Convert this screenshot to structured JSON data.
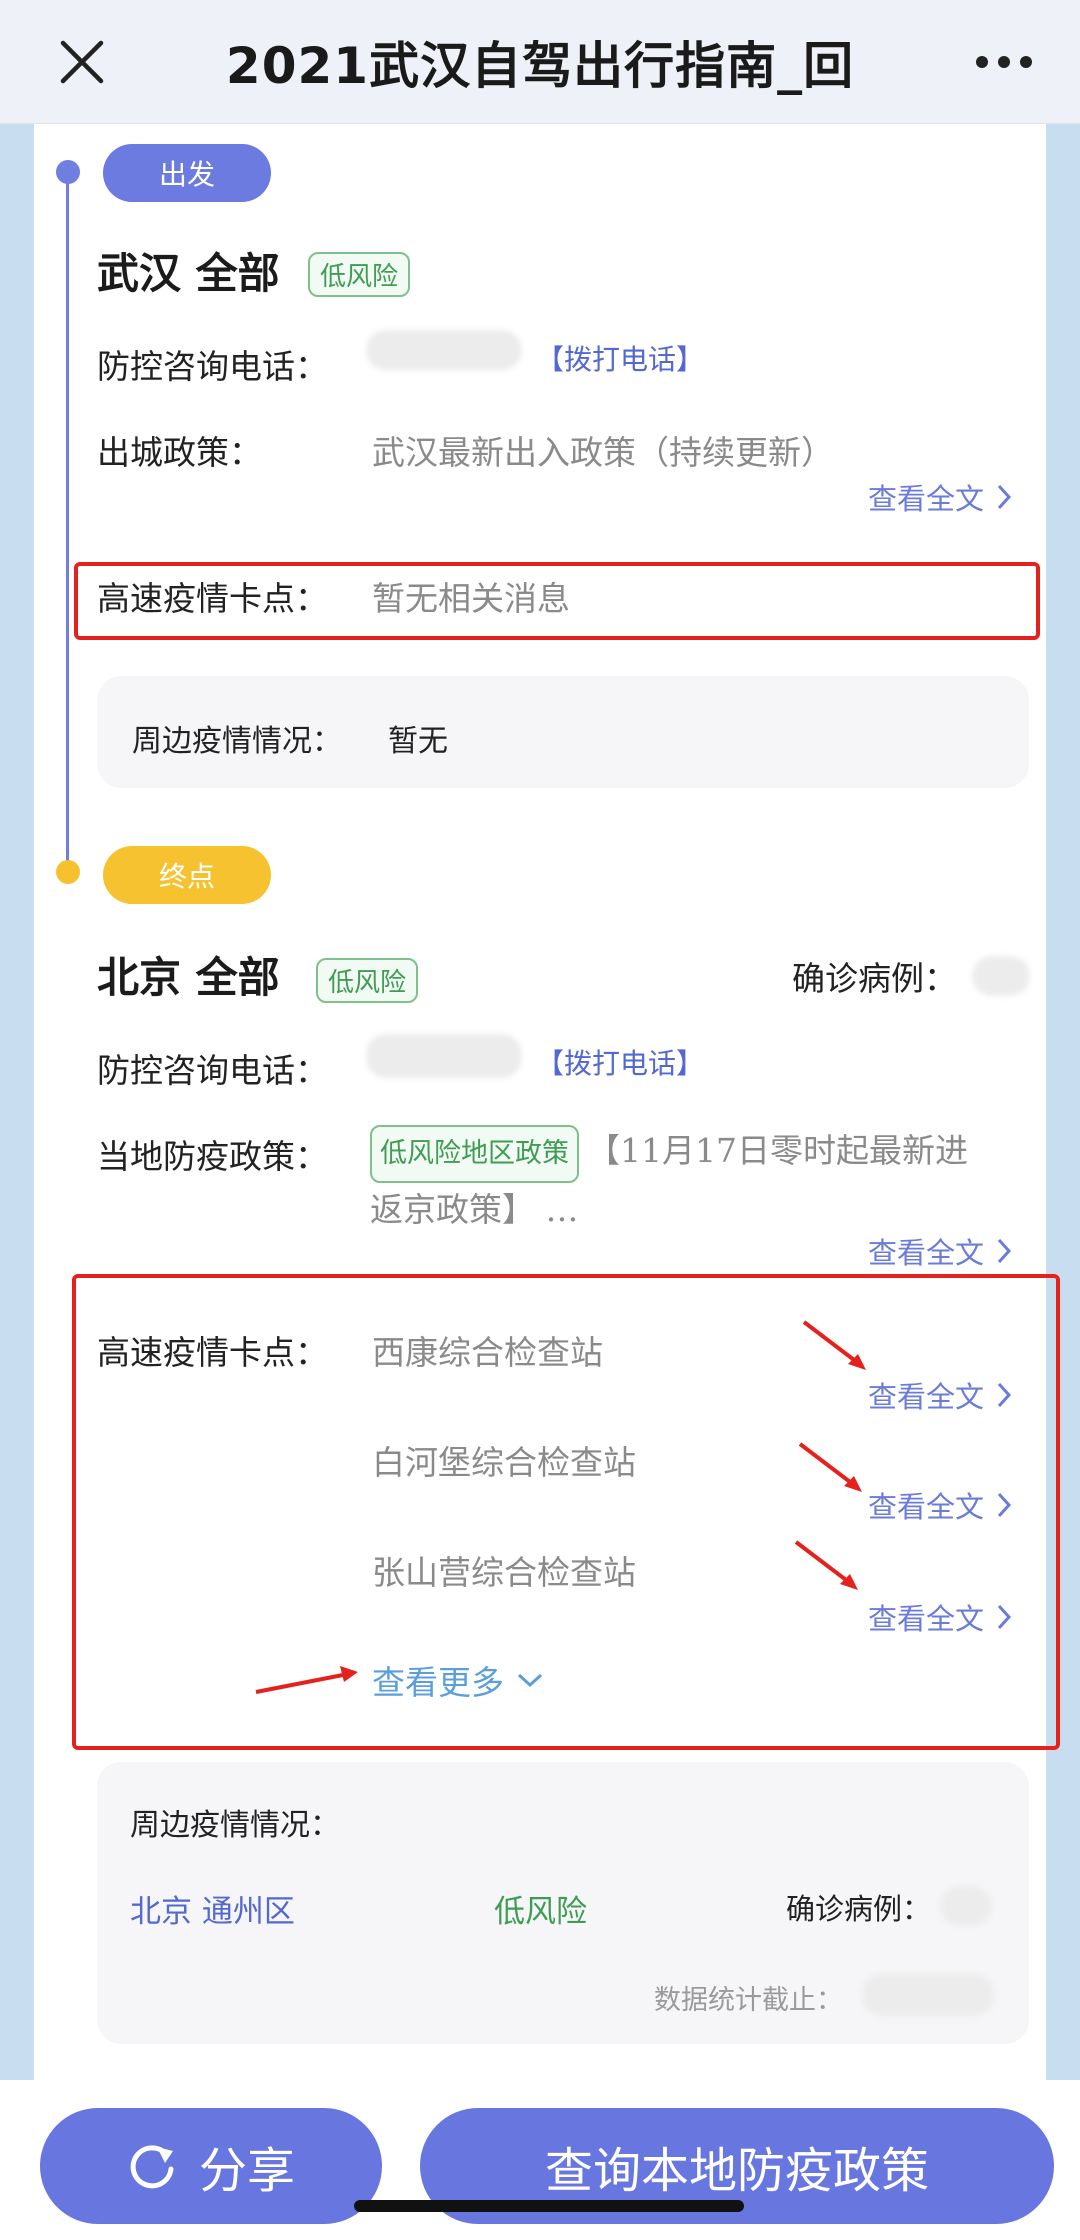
{
  "header": {
    "title": "2021武汉自驾出行指南_回",
    "close_icon": "close-icon",
    "more_icon": "more-icon"
  },
  "start": {
    "pill": "出发",
    "city": "武汉 全部",
    "risk": "低风险",
    "phone_label": "防控咨询电话：",
    "call_link": "【拨打电话】",
    "policy_label": "出城政策：",
    "policy_value": "武汉最新出入政策（持续更新）",
    "view_full": "查看全文",
    "checkpoint_label": "高速疫情卡点：",
    "checkpoint_value": "暂无相关消息",
    "surrounding_label": "周边疫情情况：",
    "surrounding_value": "暂无"
  },
  "end": {
    "pill": "终点",
    "city": "北京 全部",
    "risk": "低风险",
    "confirmed_label": "确诊病例：",
    "phone_label": "防控咨询电话：",
    "call_link": "【拨打电话】",
    "policy_label": "当地防疫政策：",
    "policy_tag": "低风险地区政策",
    "policy_text_1": "【11月17日零时起最新进",
    "policy_text_2": "返京政策】 …",
    "view_full": "查看全文",
    "checkpoint_label": "高速疫情卡点：",
    "checkpoints": [
      {
        "name": "西康综合检查站",
        "view": "查看全文"
      },
      {
        "name": "白河堡综合检查站",
        "view": "查看全文"
      },
      {
        "name": "张山营综合检查站",
        "view": "查看全文"
      }
    ],
    "view_more": "查看更多",
    "surrounding_label": "周边疫情情况：",
    "district": "北京 通州区",
    "district_risk": "低风险",
    "district_confirmed_label": "确诊病例：",
    "stats_label": "数据统计截止："
  },
  "bottom": {
    "share": "分享",
    "query": "查询本地防疫政策"
  },
  "colors": {
    "accent": "#6877e0",
    "low_risk": "#3f9c55",
    "highlight": "#e5211d",
    "end_pill": "#f7c230"
  }
}
